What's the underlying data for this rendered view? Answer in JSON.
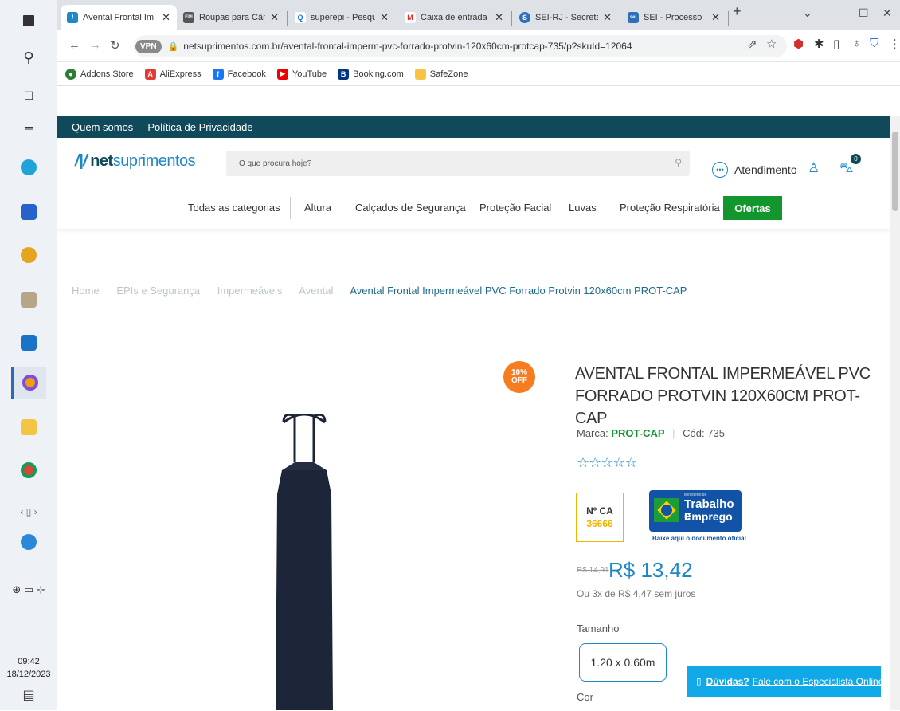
{
  "taskbar": {
    "clock_time": "09:42",
    "clock_date": "18/12/2023"
  },
  "tabs": [
    {
      "label": "Avental Frontal Im",
      "active": true,
      "fav_color": "#1e88c7",
      "fav_text": "/"
    },
    {
      "label": "Roupas para Câm",
      "active": false,
      "fav_color": "#555",
      "fav_text": "EPI"
    },
    {
      "label": "superepi - Pesqu",
      "active": false,
      "fav_color": "#1a73e8",
      "fav_text": "Q"
    },
    {
      "label": "Caixa de entrada",
      "active": false,
      "fav_color": "#d93025",
      "fav_text": "M"
    },
    {
      "label": "SEI-RJ - Secretari",
      "active": false,
      "fav_color": "#2f6fb7",
      "fav_text": "S"
    },
    {
      "label": "SEI - Processo",
      "active": false,
      "fav_color": "#2f6fb7",
      "fav_text": "sei"
    }
  ],
  "toolbar": {
    "vpn_label": "VPN",
    "url": "netsuprimentos.com.br/avental-frontal-imperm-pvc-forrado-protvin-120x60cm-protcap-735/p?skuId=12064"
  },
  "bookmarks": [
    {
      "label": "Addons Store",
      "color": "#2e7d32"
    },
    {
      "label": "AliExpress",
      "color": "#e53935"
    },
    {
      "label": "Facebook",
      "color": "#1877f2"
    },
    {
      "label": "YouTube",
      "color": "#e00"
    },
    {
      "label": "Booking.com",
      "color": "#003580"
    },
    {
      "label": "SafeZone",
      "color": "#f6c343"
    }
  ],
  "site": {
    "topbar": [
      "Quem somos",
      "Política de Privacidade"
    ],
    "logo_mark": "/|/",
    "logo_bold": "net",
    "logo_light": "suprimentos",
    "search_placeholder": "O que procura hoje?",
    "atendimento": "Atendimento",
    "cart_count": "0",
    "nav": [
      "Todas as categorias",
      "Altura",
      "Calçados de Segurança",
      "Proteção Facial",
      "Luvas",
      "Proteção Respiratória"
    ],
    "ofertas": "Ofertas",
    "breadcrumb": [
      "Home",
      "EPIs e Segurança",
      "Impermeáveis",
      "Avental"
    ],
    "breadcrumb_current": "Avental Frontal Impermeável PVC Forrado Protvin 120x60cm PROT-CAP"
  },
  "product": {
    "discount_pct": "10%",
    "discount_off": "OFF",
    "title_line1": "AVENTAL FRONTAL IMPERMEÁVEL PVC",
    "title_line2": "FORRADO PROTVIN 120X60CM PROT-CAP",
    "marca_label": "Marca:",
    "marca_value": "PROT-CAP",
    "cod": "Cód: 735",
    "stars": "☆☆☆☆☆",
    "ca_label": "Nº CA",
    "ca_number": "36666",
    "mte_small": "Ministério do",
    "mte_line1": "Trabalho e",
    "mte_line2": "Emprego",
    "mte_link": "Baixe aqui o documento oficial",
    "old_price": "R$ 14,91",
    "price": "R$ 13,42",
    "installments": "Ou 3x de R$ 4,47 sem juros",
    "size_label": "Tamanho",
    "size_value": "1.20 x 0.60m",
    "color_label": "Cor"
  },
  "help": {
    "bold": "Dúvidas?",
    "text": "Fale com o Especialista Online"
  }
}
